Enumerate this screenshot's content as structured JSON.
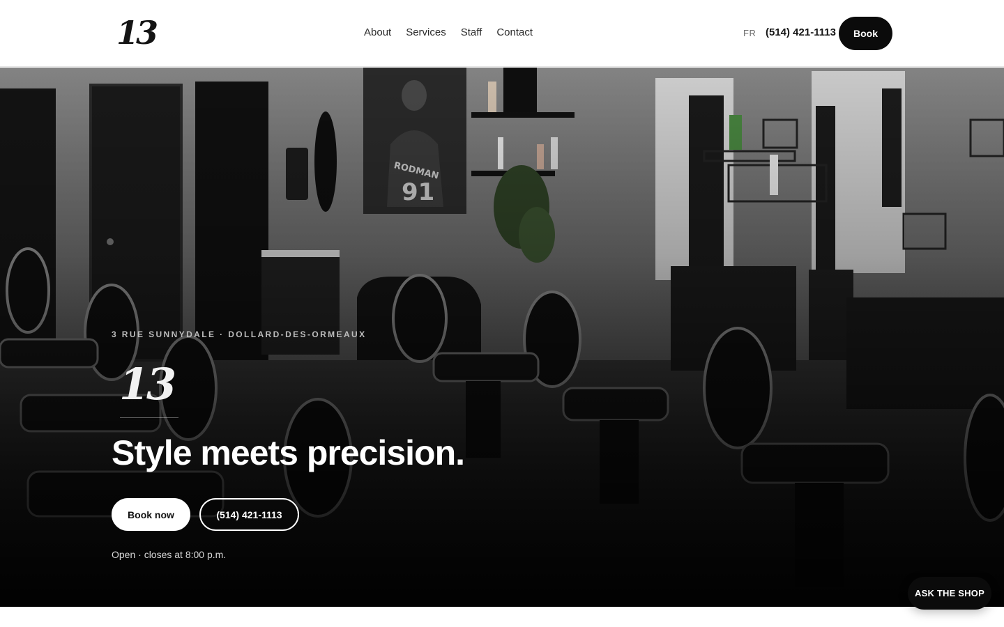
{
  "header": {
    "logo_text": "13",
    "nav": [
      {
        "label": "About"
      },
      {
        "label": "Services"
      },
      {
        "label": "Staff"
      },
      {
        "label": "Contact"
      }
    ],
    "language_toggle": "FR",
    "phone": "(514) 421-1113",
    "book_label": "Book"
  },
  "hero": {
    "address": "3 RUE SUNNYDALE · DOLLARD-DES-ORMEAUX",
    "logo_text": "13",
    "title": "Style meets precision.",
    "book_now_label": "Book now",
    "phone_label": "(514) 421-1113",
    "status": "Open · closes at 8:00 p.m.",
    "poster_text": {
      "name": "RODMAN",
      "number": "91"
    }
  },
  "chat": {
    "label": "ASK THE SHOP"
  },
  "colors": {
    "header_bg": "#ffffff",
    "primary_button": "#0b0b0b",
    "hero_text": "#ffffff"
  }
}
